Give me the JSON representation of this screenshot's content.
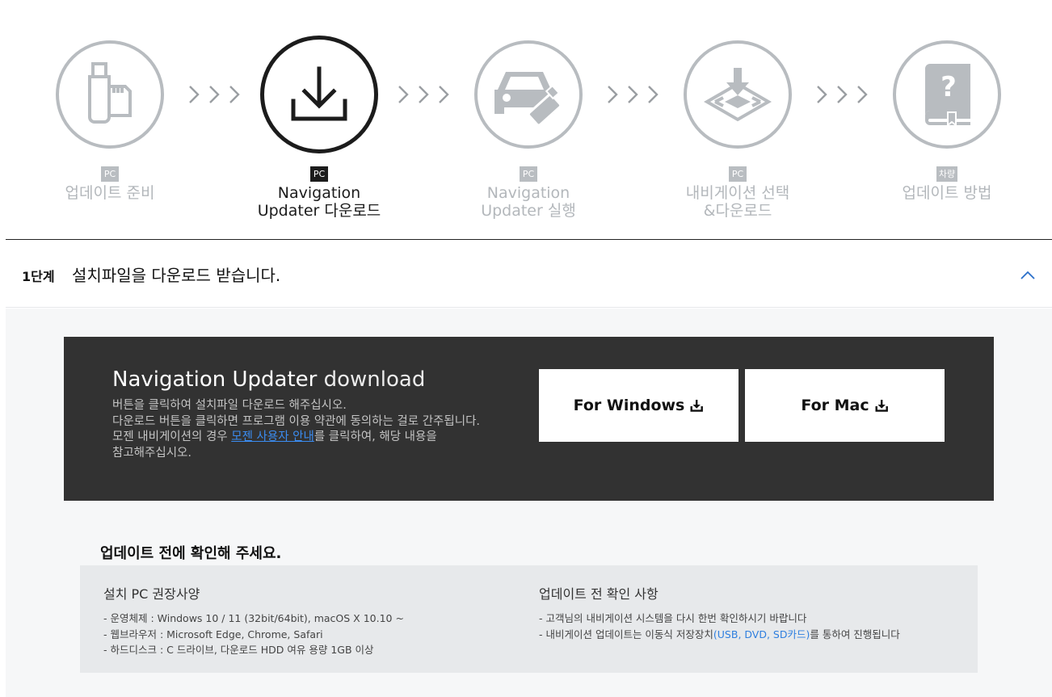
{
  "steps": [
    {
      "badge": "PC",
      "label": "업데이트 준비",
      "icon": "usb-sd-card-icon",
      "active": false
    },
    {
      "badge": "PC",
      "label": "Navigation\nUpdater 다운로드",
      "icon": "download-icon",
      "active": true
    },
    {
      "badge": "PC",
      "label": "Navigation\nUpdater 실행",
      "icon": "car-usb-icon",
      "active": false
    },
    {
      "badge": "PC",
      "label": "내비게이션 선택\n&다운로드",
      "icon": "map-download-icon",
      "active": false
    },
    {
      "badge": "차량",
      "label": "업데이트 방법",
      "icon": "help-book-icon",
      "active": false
    }
  ],
  "stage": {
    "number": "1단계",
    "title": "설치파일을 다운로드 받습니다."
  },
  "download": {
    "title_bold": "Navigation Updater",
    "title_light": " download",
    "desc_line1": "버튼을 클릭하여 설치파일 다운로드 해주십시오.",
    "desc_line2": "다운로드 버튼을 클릭하면 프로그램 이용 약관에 동의하는 걸로 간주됩니다.",
    "desc_line3_pre": "모젠 내비게이션의 경우 ",
    "desc_link": "모젠 사용자 안내",
    "desc_line3_post": "를 클릭하여, 해당 내용을",
    "desc_line4": "참고해주십시오.",
    "windows_label": "For Windows",
    "mac_label": "For Mac"
  },
  "check": {
    "title": "업데이트 전에 확인해 주세요.",
    "left_title": "설치 PC 권장사양",
    "left_items": [
      "- 운영체제 : Windows 10 / 11 (32bit/64bit), macOS X 10.10 ~",
      "- 웹브라우저 : Microsoft Edge, Chrome, Safari",
      "- 하드디스크 : C 드라이브, 다운로드 HDD 여유 용량 1GB 이상"
    ],
    "right_title": "업데이트 전 확인 사항",
    "right_item1": "- 고객님의 내비게이션 시스템을 다시 한번 확인하시기 바랍니다",
    "right_item2_pre": "- 내비게이션 업데이트는 이동식 저장장치",
    "right_item2_blue": "(USB, DVD, SD카드)",
    "right_item2_post": "를 통하여 진행됩니다"
  },
  "colors": {
    "inactive": "#b3b7bb",
    "active": "#1c1c1c",
    "panel": "#323232",
    "link": "#3b8cf0"
  }
}
